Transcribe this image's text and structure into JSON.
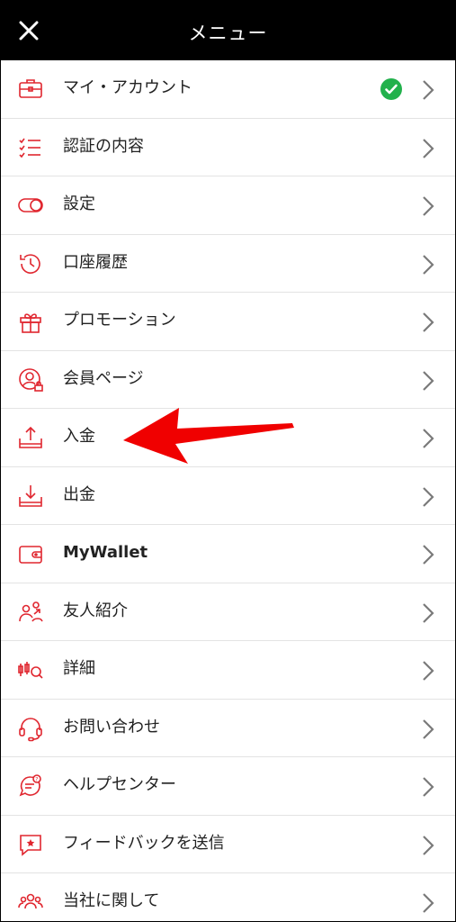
{
  "header": {
    "title": "メニュー",
    "close_icon": "close-icon"
  },
  "menu": {
    "items": [
      {
        "label": "マイ・アカウント",
        "icon": "briefcase-icon",
        "verified": true
      },
      {
        "label": "認証の内容",
        "icon": "checklist-icon"
      },
      {
        "label": "設定",
        "icon": "toggle-icon"
      },
      {
        "label": "口座履歴",
        "icon": "clock-history-icon"
      },
      {
        "label": "プロモーション",
        "icon": "gift-icon"
      },
      {
        "label": "会員ページ",
        "icon": "user-lock-icon"
      },
      {
        "label": "入金",
        "icon": "upload-tray-icon"
      },
      {
        "label": "出金",
        "icon": "download-tray-icon"
      },
      {
        "label": "MyWallet",
        "icon": "wallet-icon"
      },
      {
        "label": "友人紹介",
        "icon": "referral-users-icon"
      },
      {
        "label": "詳細",
        "icon": "candlestick-search-icon"
      },
      {
        "label": "お問い合わせ",
        "icon": "headset-icon"
      },
      {
        "label": "ヘルプセンター",
        "icon": "help-chat-icon"
      },
      {
        "label": "フィードバックを送信",
        "icon": "feedback-star-icon"
      },
      {
        "label": "当社に関して",
        "icon": "group-icon"
      }
    ]
  },
  "colors": {
    "accent": "#e0262f",
    "check": "#22b14c",
    "chevron": "#7a7a7a",
    "header_bg": "#000000"
  },
  "annotation": {
    "type": "red-arrow",
    "points_to": "入金"
  }
}
